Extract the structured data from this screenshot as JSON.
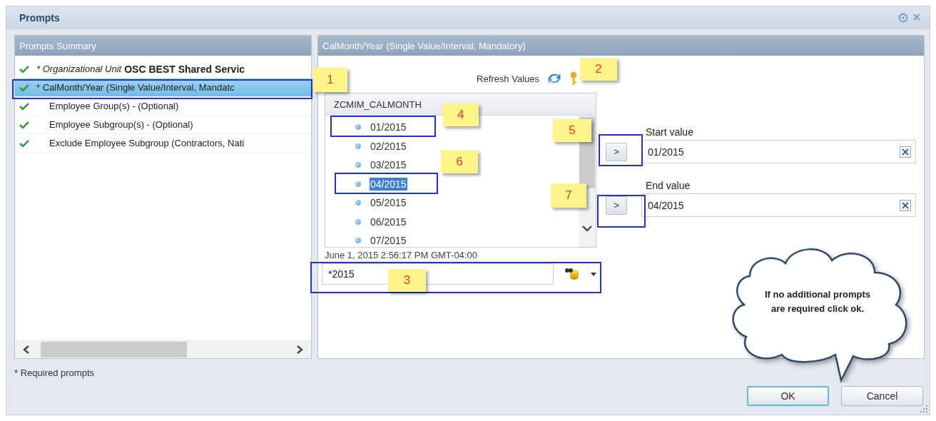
{
  "window": {
    "title": "Prompts"
  },
  "summary": {
    "title": "Prompts Summary",
    "items": [
      {
        "kind": "named",
        "name": "* Organizational Unit",
        "value": "OSC BEST Shared Servic",
        "checked": true,
        "selected": false
      },
      {
        "kind": "plain",
        "label": "* CalMonth/Year (Single Value/Interval, Mandatc",
        "checked": true,
        "selected": true
      },
      {
        "kind": "plain",
        "label": "Employee Group(s) - (Optional)",
        "checked": true,
        "selected": false
      },
      {
        "kind": "plain",
        "label": "Employee Subgroup(s) - (Optional)",
        "checked": true,
        "selected": false
      },
      {
        "kind": "plain",
        "label": "Exclude Employee Subgroup (Contractors, Nati",
        "checked": true,
        "selected": false
      }
    ]
  },
  "detail": {
    "title": "CalMonth/Year (Single Value/Interval, Mandatory)",
    "refresh": "Refresh Values",
    "list_header": "ZCMIM_CALMONTH",
    "values": [
      {
        "label": "01/2015",
        "selected": false
      },
      {
        "label": "02/2015",
        "selected": false
      },
      {
        "label": "03/2015",
        "selected": false
      },
      {
        "label": "04/2015",
        "selected": true
      },
      {
        "label": "05/2015",
        "selected": false
      },
      {
        "label": "06/2015",
        "selected": false
      },
      {
        "label": "07/2015",
        "selected": false
      }
    ],
    "timestamp": "June 1, 2015 2:56:17 PM GMT-04:00",
    "search": {
      "value": "*2015"
    },
    "range": [
      {
        "label": "Start value",
        "button": ">",
        "value": "01/2015"
      },
      {
        "label": "End value",
        "button": ">",
        "value": "04/2015"
      }
    ]
  },
  "footnote": "* Required prompts",
  "note": "If no additional prompts are required click ok.",
  "buttons": [
    {
      "label": "OK",
      "default": true
    },
    {
      "label": "Cancel",
      "default": false
    }
  ],
  "annotations": [
    {
      "label": "1"
    },
    {
      "label": "2"
    },
    {
      "label": "3"
    },
    {
      "label": "4"
    },
    {
      "label": "5"
    },
    {
      "label": "6"
    },
    {
      "label": "7"
    }
  ]
}
